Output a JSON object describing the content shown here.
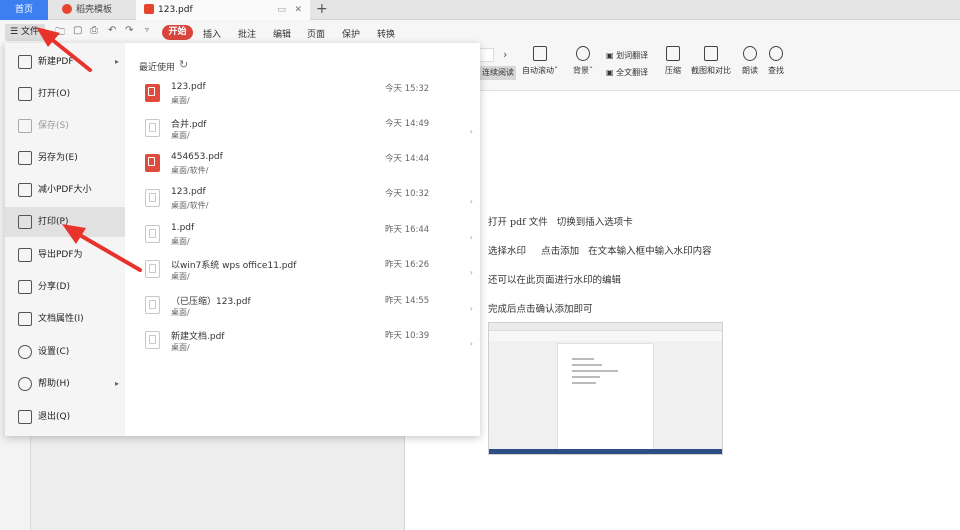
{
  "tabs": {
    "home": "首页",
    "template": "稻壳模板",
    "pdf": "123.pdf"
  },
  "toolbar": {
    "file_label": "文件",
    "start_label": "开始",
    "menu_tabs": [
      "插入",
      "批注",
      "编辑",
      "页面",
      "保护",
      "转换"
    ]
  },
  "ribbon": {
    "continuous": "连续阅读",
    "autoscroll": "自动滚动",
    "background": "背景",
    "word_translate": "划词翻译",
    "full_translate": "全文翻译",
    "compress": "压缩",
    "capture_compare": "截图和对比",
    "read_aloud": "朗读",
    "find": "查找"
  },
  "file_menu": {
    "items": [
      {
        "label": "新建PDF",
        "enabled": true,
        "submenu": true
      },
      {
        "label": "打开(O)",
        "enabled": true
      },
      {
        "label": "保存(S)",
        "enabled": false
      },
      {
        "label": "另存为(E)",
        "enabled": true
      },
      {
        "label": "减小PDF大小",
        "enabled": true
      },
      {
        "label": "打印(P)",
        "enabled": true,
        "hovered": true
      },
      {
        "label": "导出PDF为",
        "enabled": true
      },
      {
        "label": "分享(D)",
        "enabled": true
      },
      {
        "label": "文档属性(I)",
        "enabled": true
      },
      {
        "label": "设置(C)",
        "enabled": true
      },
      {
        "label": "帮助(H)",
        "enabled": true,
        "submenu": true
      },
      {
        "label": "退出(Q)",
        "enabled": true
      }
    ],
    "recent_header": "最近使用",
    "recent": [
      {
        "name": "123.pdf",
        "path": "桌面/",
        "time": "今天 15:32"
      },
      {
        "name": "合并.pdf",
        "path": "桌面/",
        "time": "今天 14:49"
      },
      {
        "name": "454653.pdf",
        "path": "桌面/软件/",
        "time": "今天 14:44"
      },
      {
        "name": "123.pdf",
        "path": "桌面/软件/",
        "time": "今天 10:32"
      },
      {
        "name": "1.pdf",
        "path": "桌面/",
        "time": "昨天 16:44"
      },
      {
        "name": "以win7系统 wps office11.pdf",
        "path": "桌面/",
        "time": "昨天 16:26"
      },
      {
        "name": "（已压缩）123.pdf",
        "path": "桌面/",
        "time": "昨天 14:55"
      },
      {
        "name": "新建文档.pdf",
        "path": "桌面/",
        "time": "昨天 10:39"
      }
    ]
  },
  "document": {
    "lines": [
      "打开 pdf 文件   切换到插入选项卡",
      "选择水印     点击添加   在文本输入框中输入水印内容",
      "还可以在此页面进行水印的编辑",
      "完成后点击确认添加即可"
    ]
  },
  "colors": {
    "accent_blue": "#3b7ff0",
    "brand_red": "#d9453d",
    "arrow_red": "#e8332c"
  }
}
